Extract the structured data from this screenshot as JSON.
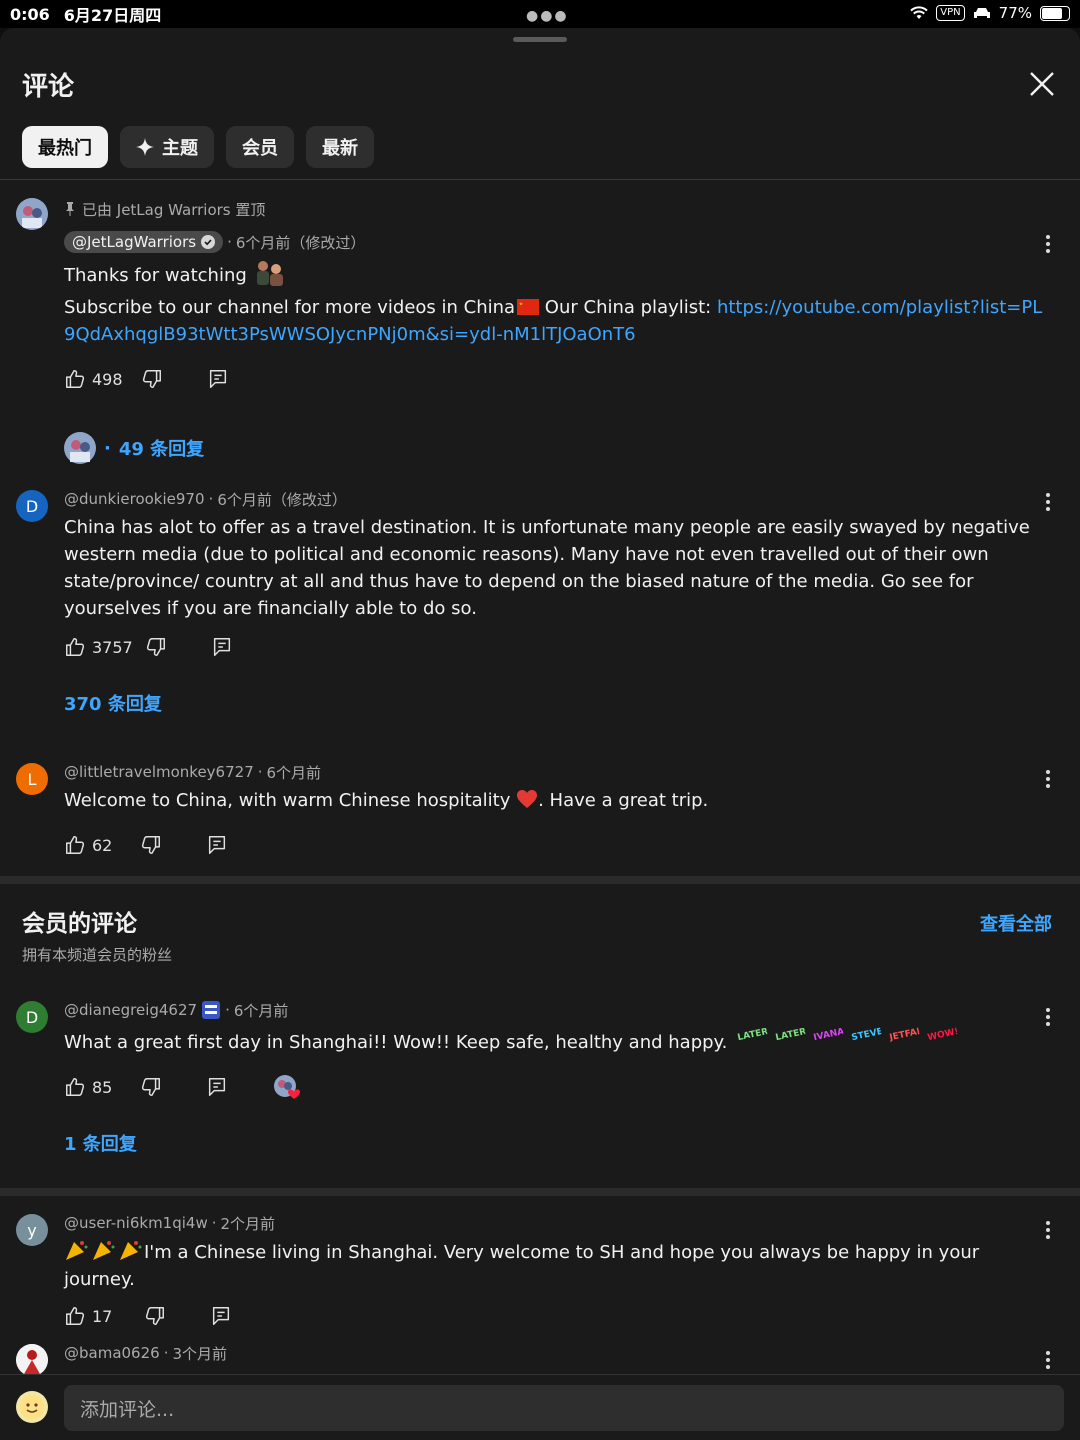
{
  "status_bar": {
    "time": "0:06",
    "date": "6月27日周四",
    "vpn": "VPN",
    "battery": "77%",
    "battery_level": 0.77
  },
  "sheet": {
    "title": "评论"
  },
  "chips": [
    {
      "label": "最热门",
      "active": true
    },
    {
      "label": "主题",
      "icon": "sparkle-icon"
    },
    {
      "label": "会员"
    },
    {
      "label": "最新"
    }
  ],
  "comments": [
    {
      "pinned_label": "已由 JetLag Warriors 置顶",
      "author": "@JetLagWarriors",
      "time": "6个月前（修改过）",
      "line1": "Thanks for watching",
      "line2_prefix": "Subscribe to our channel for more videos in China",
      "line2_mid": " Our China playlist: ",
      "link": "https://youtube.com/playlist?list=PL9QdAxhqglB93tWtt3PsWWSOJycnPNj0m&si=ydl-nM1lTJOaOnT6",
      "likes": "498",
      "replies": "49 条回复"
    },
    {
      "avatar_letter": "D",
      "avatar_color": "#1565c0",
      "author": "@dunkierookie970",
      "time": "6个月前（修改过）",
      "text": "China has alot to offer as a travel destination. It is unfortunate many people are easily swayed by negative western media (due to political and economic reasons). Many have not even travelled out of their own state/province/ country at all and thus have to depend on the biased nature of the media. Go see for yourselves if you are financially able to do so.",
      "likes": "3757",
      "replies": "370 条回复"
    },
    {
      "avatar_letter": "L",
      "avatar_color": "#ef6c00",
      "author": "@littletravelmonkey6727",
      "time": "6个月前",
      "text_a": "Welcome to China, with warm Chinese hospitality",
      "text_b": ". Have a great trip.",
      "likes": "62"
    }
  ],
  "members": {
    "title": "会员的评论",
    "subtitle": "拥有本频道会员的粉丝",
    "see_all": "查看全部",
    "comment": {
      "avatar_letter": "D",
      "avatar_color": "#2e7d32",
      "author": "@dianegreig4627",
      "time": "6个月前",
      "text": "What a great first day in Shanghai!! Wow!! Keep safe, healthy and happy.",
      "stickers": [
        "LATER",
        "LATER",
        "IVANA",
        "STEVE",
        "JETFAM",
        "WOW!"
      ],
      "likes": "85",
      "replies": "1 条回复"
    }
  },
  "more_comments": [
    {
      "avatar_letter": "y",
      "avatar_color": "#78909c",
      "author": "@user-ni6km1qi4w",
      "time": "2个月前",
      "text": "I'm a Chinese living in Shanghai. Very welcome to SH and hope you always be happy in your journey.",
      "likes": "17"
    },
    {
      "author": "@bama0626",
      "time": "3个月前"
    }
  ],
  "composer": {
    "placeholder": "添加评论..."
  },
  "colors": {
    "accent": "#3ea6ff",
    "background": "#1a1a1a",
    "chip": "#2e2e2e"
  }
}
